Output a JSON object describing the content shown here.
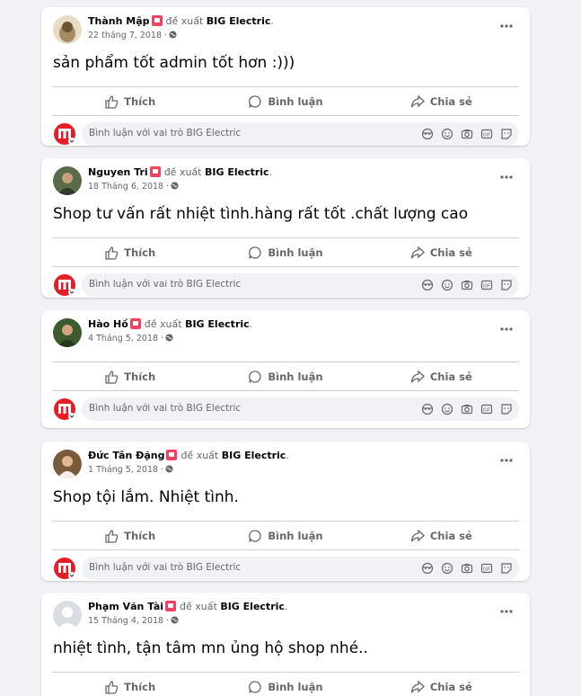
{
  "recommend_text": "đề xuất",
  "page_name": "BIG Electric",
  "actions": {
    "like": "Thích",
    "comment": "Bình luận",
    "share": "Chia sẻ"
  },
  "comment_placeholder": "Bình luận với vai trò BIG Electric",
  "posts": [
    {
      "author": "Thành Mập",
      "date": "22 tháng 7, 2018",
      "text": "sản phẩm tốt admin tốt hơn :)))"
    },
    {
      "author": "Nguyen Tri",
      "date": "18 Tháng 6, 2018",
      "text": "Shop tư vấn rất nhiệt tình.hàng rất tốt .chất lượng cao"
    },
    {
      "author": "Hào Hồ",
      "date": "4 Tháng 5, 2018",
      "text": ""
    },
    {
      "author": "Đức Tân Đặng",
      "date": "1 Tháng 5, 2018",
      "text": "Shop tội lắm. Nhiệt tình."
    },
    {
      "author": "Phạm Văn Tài",
      "date": "15 Tháng 4, 2018",
      "text": "nhiệt tình, tận tâm mn ủng hộ shop nhé.."
    }
  ],
  "colors": {
    "badge": "#f3425f",
    "page_logo": "#e41e26",
    "muted": "#65676b",
    "bg": "#f0f2f5"
  }
}
